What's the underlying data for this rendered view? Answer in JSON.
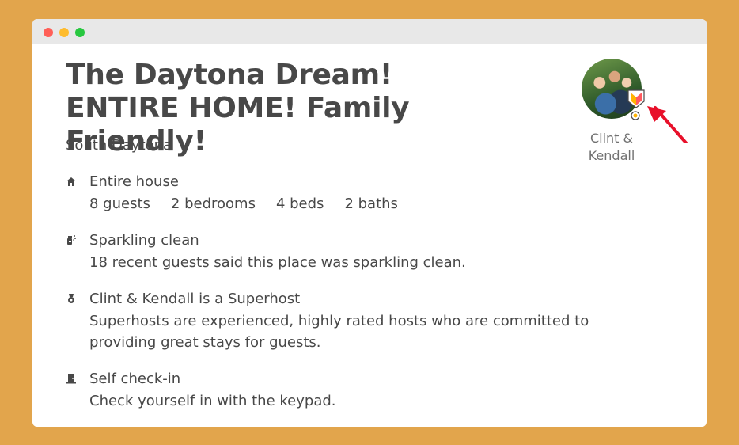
{
  "listing": {
    "title": "The Daytona Dream! ENTIRE HOME! Family Friendly!",
    "location": "South Daytona"
  },
  "host": {
    "name": "Clint & Kendall",
    "avatar": "host-photo",
    "badge_icon": "superhost-shield-icon"
  },
  "features": [
    {
      "icon": "house-icon",
      "title": "Entire house",
      "stats": [
        "8 guests",
        "2 bedrooms",
        "4 beds",
        "2 baths"
      ]
    },
    {
      "icon": "spray-bottle-icon",
      "title": "Sparkling clean",
      "description": "18 recent guests said this place was sparkling clean."
    },
    {
      "icon": "medal-icon",
      "title": "Clint & Kendall is a Superhost",
      "description": "Superhosts are experienced, highly rated hosts who are committed to providing great stays for guests."
    },
    {
      "icon": "door-icon",
      "title": "Self check-in",
      "description": "Check yourself in with the keypad."
    }
  ],
  "colors": {
    "background": "#E2A54C",
    "text": "#484848",
    "muted": "#717171",
    "arrow": "#E8102A"
  }
}
